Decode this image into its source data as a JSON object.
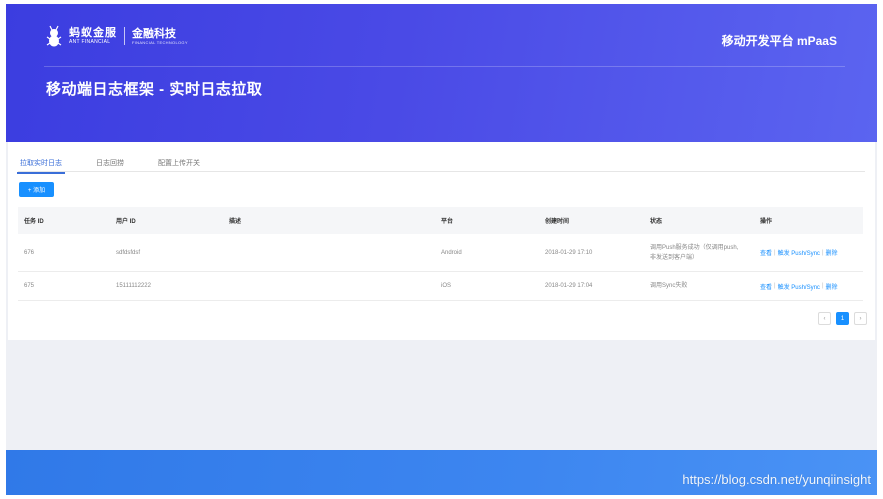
{
  "header": {
    "brand_cn": "蚂蚁金服",
    "brand_en": "ANT FINANCIAL",
    "fin_cn": "金融科技",
    "fin_en": "FINANCIAL TECHNOLOGY",
    "platform": "移动开发平台 mPaaS",
    "title": "移动端日志框架 - 实时日志拉取"
  },
  "tabs": [
    {
      "label": "拉取实时日志",
      "active": true
    },
    {
      "label": "日志回捞",
      "active": false
    },
    {
      "label": "配置上传开关",
      "active": false
    }
  ],
  "add_button": "+ 添加",
  "table": {
    "columns": [
      "任务 ID",
      "用户 ID",
      "描述",
      "平台",
      "创建时间",
      "状态",
      "操作"
    ],
    "rows": [
      {
        "task_id": "676",
        "user_id": "sdfdsfdsf",
        "desc": "",
        "platform": "Android",
        "created": "2018-01-29 17:10",
        "status_l1": "调用Push服务成功（仅调用push,",
        "status_l2": "非发送到客户端）"
      },
      {
        "task_id": "675",
        "user_id": "15111112222",
        "desc": "",
        "platform": "iOS",
        "created": "2018-01-29 17:04",
        "status_l1": "调用Sync失败",
        "status_l2": ""
      }
    ],
    "ops": {
      "view": "查看",
      "trigger": "触发 Push/Sync",
      "delete": "删除",
      "sep": "|"
    }
  },
  "pagination": {
    "prev": "‹",
    "current": "1",
    "next": "›"
  },
  "watermark": "https://blog.csdn.net/yunqiinsight",
  "colors": {
    "hero": "#4a4ae6",
    "accent": "#1890ff",
    "footer": "#3d86f0"
  }
}
